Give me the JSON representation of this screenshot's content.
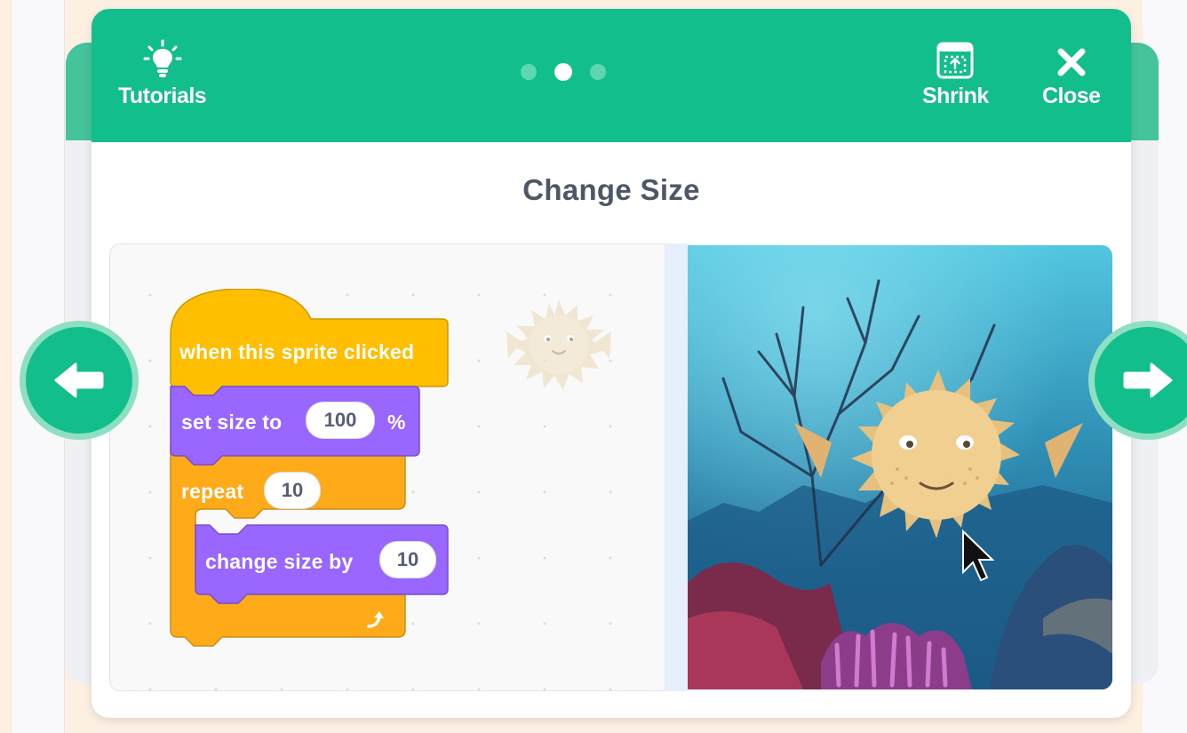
{
  "header": {
    "tutorials_label": "Tutorials",
    "shrink_label": "Shrink",
    "close_label": "Close",
    "steps": {
      "count": 3,
      "active_index": 1
    }
  },
  "step": {
    "title": "Change Size"
  },
  "code": {
    "hat_block": "when this sprite clicked",
    "set_size": {
      "label": "set size to",
      "value": "100",
      "unit": "%"
    },
    "repeat": {
      "label": "repeat",
      "value": "10"
    },
    "change_size": {
      "label": "change size by",
      "value": "10"
    }
  },
  "icons": {
    "tutorials": "lightbulb-icon",
    "shrink": "shrink-icon",
    "close": "close-icon",
    "prev": "arrow-left-icon",
    "next": "arrow-right-icon",
    "loop": "loop-arrow-icon"
  },
  "colors": {
    "header": "#12bf8c",
    "events_block": "#ffbf00",
    "looks_block": "#9966ff",
    "control_block": "#ffab19",
    "title_text": "#4d5766"
  }
}
